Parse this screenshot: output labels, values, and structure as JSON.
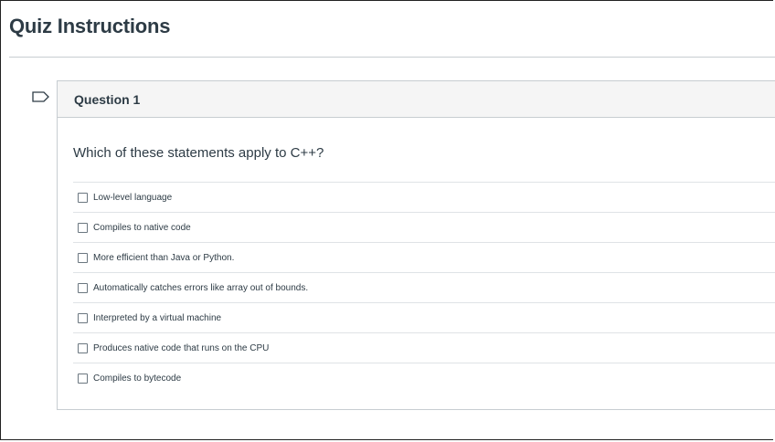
{
  "page": {
    "title": "Quiz Instructions"
  },
  "question": {
    "name": "Question 1",
    "text": "Which of these statements apply to C++?",
    "flag_icon": "flag-outline-icon",
    "answers": [
      {
        "label": "Low-level language",
        "checked": false
      },
      {
        "label": "Compiles to native code",
        "checked": false
      },
      {
        "label": "More efficient than Java or Python.",
        "checked": false
      },
      {
        "label": "Automatically catches errors like array out of bounds.",
        "checked": false
      },
      {
        "label": "Interpreted by a virtual machine",
        "checked": false
      },
      {
        "label": "Produces native code that runs on the CPU",
        "checked": false
      },
      {
        "label": "Compiles to bytecode",
        "checked": false
      }
    ]
  },
  "colors": {
    "text": "#2d3b45",
    "header_bg": "#f5f5f5",
    "border": "#c7cdd1"
  }
}
